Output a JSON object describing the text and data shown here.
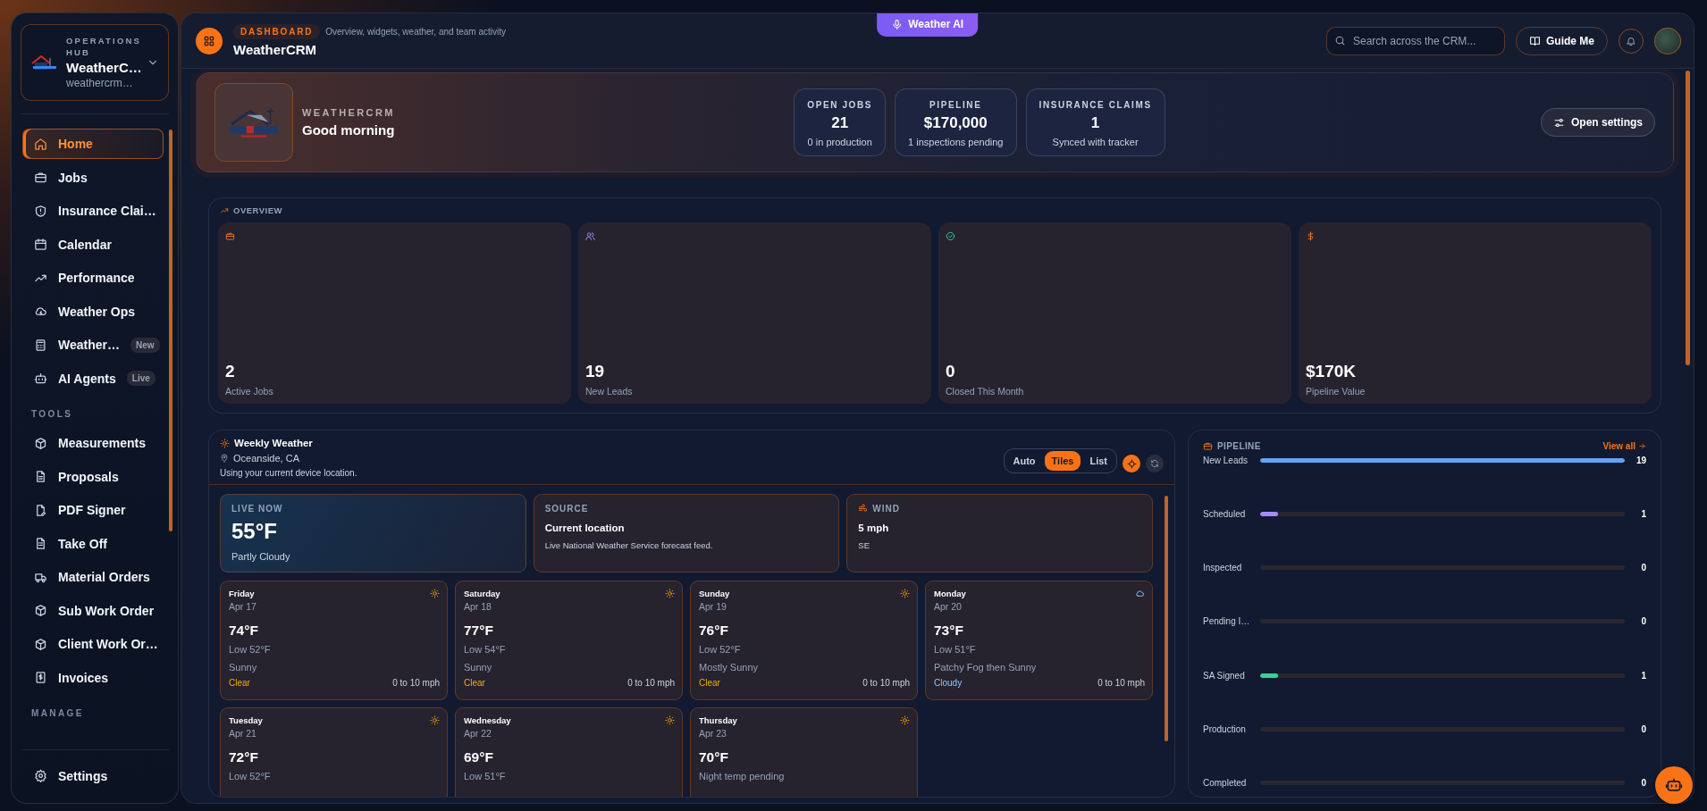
{
  "sidebar": {
    "brand": {
      "eyebrow": "OPERATIONS HUB",
      "name": "WeatherC…",
      "sub": "weathercrm…"
    },
    "sections": [
      {
        "items": [
          {
            "label": "Home",
            "selected": true
          },
          {
            "label": "Jobs",
            "selected": false
          },
          {
            "label": "Insurance Clai…",
            "selected": false
          },
          {
            "label": "Calendar",
            "selected": false
          },
          {
            "label": "Performance",
            "selected": false
          },
          {
            "label": "Weather Ops",
            "selected": false
          },
          {
            "label": "Weather…",
            "badge": "New",
            "selected": false
          },
          {
            "label": "AI Agents",
            "badge": "Live",
            "selected": false
          }
        ]
      },
      {
        "heading": "TOOLS",
        "items": [
          {
            "label": "Measurements",
            "selected": false
          },
          {
            "label": "Proposals",
            "selected": false
          },
          {
            "label": "PDF Signer",
            "selected": false
          },
          {
            "label": "Take Off",
            "selected": false
          },
          {
            "label": "Material Orders",
            "selected": false
          },
          {
            "label": "Sub Work Order",
            "selected": false
          },
          {
            "label": "Client Work Or…",
            "selected": false
          },
          {
            "label": "Invoices",
            "selected": false
          }
        ]
      },
      {
        "heading": "MANAGE"
      }
    ],
    "footer": [
      {
        "label": "Settings",
        "selected": false
      }
    ]
  },
  "header": {
    "badge": "DASHBOARD",
    "subtitle": "Overview, widgets, weather, and team activity",
    "title": "WeatherCRM",
    "ai_button": "Weather AI",
    "search": {
      "placeholder": "Search across the CRM..."
    },
    "guide_button": "Guide Me"
  },
  "hero": {
    "eyebrow": "WEATHERCRM",
    "greeting": "Good morning",
    "stats": [
      {
        "label": "OPEN JOBS",
        "value": "21",
        "note": "0 in production"
      },
      {
        "label": "PIPELINE",
        "value": "$170,000",
        "note": "1 inspections pending"
      },
      {
        "label": "INSURANCE CLAIMS",
        "value": "1",
        "note": "Synced with tracker"
      }
    ],
    "settings_button": "Open settings"
  },
  "overview": {
    "title": "OVERVIEW",
    "cards": [
      {
        "value": "2",
        "label": "Active Jobs"
      },
      {
        "value": "19",
        "label": "New Leads"
      },
      {
        "value": "0",
        "label": "Closed This Month"
      },
      {
        "value": "$170K",
        "label": "Pipeline Value"
      }
    ]
  },
  "weather": {
    "title": "Weekly Weather",
    "location": "Oceanside, CA",
    "note": "Using your current device location.",
    "views": [
      {
        "label": "Auto",
        "selected": false
      },
      {
        "label": "Tiles",
        "selected": true
      },
      {
        "label": "List",
        "selected": false
      }
    ],
    "live": {
      "label": "LIVE NOW",
      "temp": "55°F",
      "condition": "Partly Cloudy"
    },
    "source": {
      "label": "SOURCE",
      "title": "Current location",
      "text": "Live National Weather Service forecast feed."
    },
    "wind": {
      "label": "WIND",
      "speed": "5 mph",
      "direction": "SE"
    },
    "days": [
      {
        "kind": "sunny",
        "day": "Friday",
        "date": "Apr 17",
        "high": "74°F",
        "low": "Low 52°F",
        "condition": "Sunny",
        "tag": "Clear",
        "wind": "0 to 10 mph"
      },
      {
        "kind": "sunny",
        "day": "Saturday",
        "date": "Apr 18",
        "high": "77°F",
        "low": "Low 54°F",
        "condition": "Sunny",
        "tag": "Clear",
        "wind": "0 to 10 mph"
      },
      {
        "kind": "sunny",
        "day": "Sunday",
        "date": "Apr 19",
        "high": "76°F",
        "low": "Low 52°F",
        "condition": "Mostly Sunny",
        "tag": "Clear",
        "wind": "0 to 10 mph"
      },
      {
        "kind": "cloudy",
        "day": "Monday",
        "date": "Apr 20",
        "high": "73°F",
        "low": "Low 51°F",
        "condition": "Patchy Fog then Sunny",
        "tag": "Cloudy",
        "wind": "0 to 10 mph"
      },
      {
        "kind": "sunny",
        "day": "Tuesday",
        "date": "Apr 21",
        "high": "72°F",
        "low": "Low 52°F"
      },
      {
        "kind": "sunny",
        "day": "Wednesday",
        "date": "Apr 22",
        "high": "69°F",
        "low": "Low 51°F"
      },
      {
        "kind": "sunny",
        "day": "Thursday",
        "date": "Apr 23",
        "high": "70°F",
        "low": "Night temp pending"
      }
    ]
  },
  "pipeline": {
    "title": "PIPELINE",
    "link": "View all",
    "stages": [
      {
        "label": "New Leads",
        "value": "19",
        "level": 1,
        "color": "#60a5fa"
      },
      {
        "label": "Scheduled",
        "value": "1",
        "level": 0.05,
        "color": "#a78bfa"
      },
      {
        "label": "Inspected",
        "value": "0"
      },
      {
        "label": "Pending I…",
        "value": "0"
      },
      {
        "label": "SA Signed",
        "value": "1",
        "level": 0.05,
        "color": "#34d399"
      },
      {
        "label": "Production",
        "value": "0"
      },
      {
        "label": "Completed",
        "value": "0"
      }
    ]
  }
}
